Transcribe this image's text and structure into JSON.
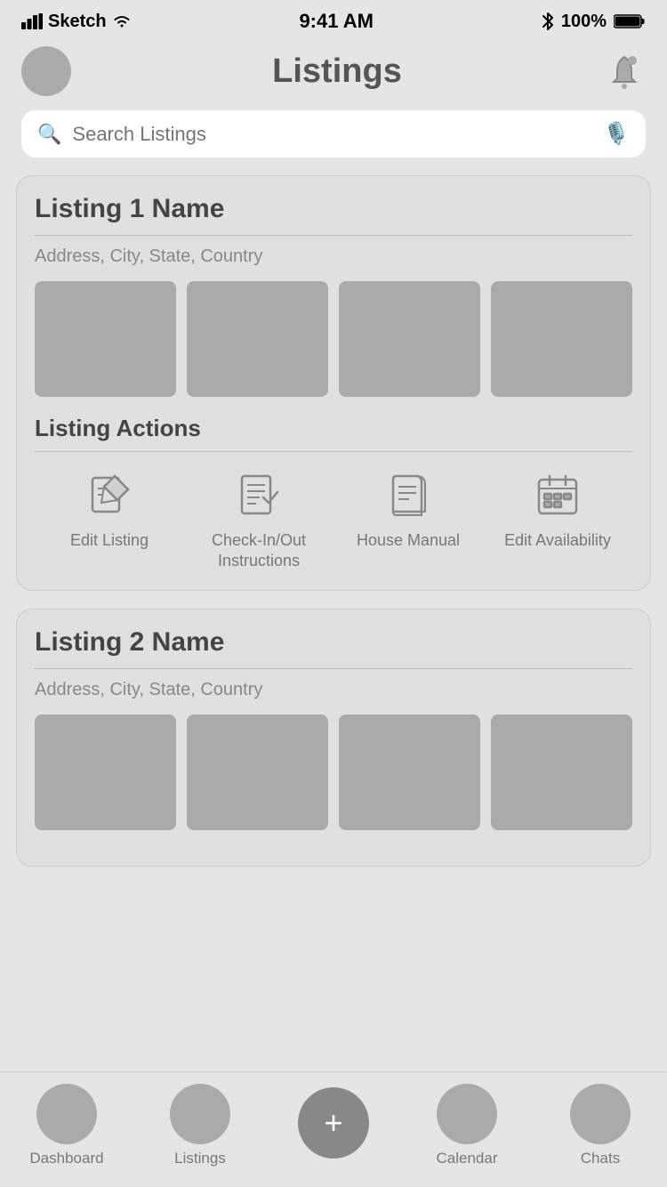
{
  "statusBar": {
    "carrier": "Sketch",
    "time": "9:41 AM",
    "battery": "100%"
  },
  "header": {
    "title": "Listings",
    "bellLabel": "notifications"
  },
  "search": {
    "placeholder": "Search Listings"
  },
  "listings": [
    {
      "id": "listing-1",
      "title": "Listing 1 Name",
      "address": "Address, City, State, Country",
      "actions": [
        {
          "id": "edit-listing",
          "label": "Edit\nListing",
          "icon": "edit"
        },
        {
          "id": "checkin-instructions",
          "label": "Check-In/Out\nInstructions",
          "icon": "checklist"
        },
        {
          "id": "house-manual",
          "label": "House\nManual",
          "icon": "book"
        },
        {
          "id": "edit-availability",
          "label": "Edit\nAvailability",
          "icon": "calendar"
        }
      ]
    },
    {
      "id": "listing-2",
      "title": "Listing 2 Name",
      "address": "Address, City, State, Country",
      "actions": []
    }
  ],
  "bottomNav": {
    "items": [
      {
        "id": "dashboard",
        "label": "Dashboard"
      },
      {
        "id": "listings",
        "label": "Listings"
      },
      {
        "id": "add",
        "label": ""
      },
      {
        "id": "calendar",
        "label": "Calendar"
      },
      {
        "id": "chats",
        "label": "Chats"
      }
    ]
  }
}
